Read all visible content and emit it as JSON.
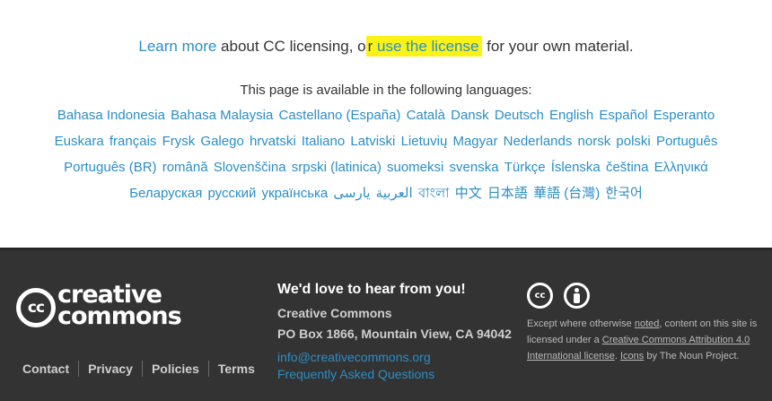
{
  "cta": {
    "learn_more": "Learn more",
    "mid_text": " about CC licensing, o",
    "highlight_r": "r ",
    "use_license": "use the license",
    "tail": " for your own material."
  },
  "languages": {
    "intro": "This page is available in the following languages:",
    "rows": [
      [
        "Bahasa Indonesia",
        "Bahasa Malaysia",
        "Castellano (España)",
        "Català",
        "Dansk",
        "Deutsch",
        "English",
        "Español",
        "Esperanto"
      ],
      [
        "Euskara",
        "français",
        "Frysk",
        "Galego",
        "hrvatski",
        "Italiano",
        "Latviski",
        "Lietuvių",
        "Magyar",
        "Nederlands",
        "norsk",
        "polski",
        "Português"
      ],
      [
        "Português (BR)",
        "română",
        "Slovenščina",
        "srpski (latinica)",
        "suomeksi",
        "svenska",
        "Türkçe",
        "Íslenska",
        "čeština",
        "Ελληνικά"
      ],
      [
        "Беларуская",
        "русский",
        "українська",
        "العربية",
        "یارسی",
        "বাংলা",
        "中文",
        "日本語",
        "華語 (台灣)",
        "한국어"
      ]
    ]
  },
  "footer": {
    "logo": {
      "mark": "cc",
      "word1": "creative",
      "word2": "commons"
    },
    "nav": [
      "Contact",
      "Privacy",
      "Policies",
      "Terms"
    ],
    "contact": {
      "heading": "We'd love to hear from you!",
      "org": "Creative Commons",
      "address": "PO Box 1866, Mountain View, CA 94042",
      "email": "info@creativecommons.org",
      "faq": "Frequently Asked Questions"
    },
    "license_icons": [
      "cc-license-icon",
      "attribution-icon"
    ],
    "license_text": {
      "t1": "Except where otherwise ",
      "noted": "noted",
      "t2": ", content on this site is licensed under a ",
      "license_link": "Creative Commons Attribution 4.0 International license",
      "t3": ". ",
      "icons_link": "Icons",
      "t4": " by The Noun Project."
    }
  },
  "colors": {
    "link": "#2b8ec6",
    "highlight": "#fbf216",
    "footer_bg": "#333333"
  }
}
